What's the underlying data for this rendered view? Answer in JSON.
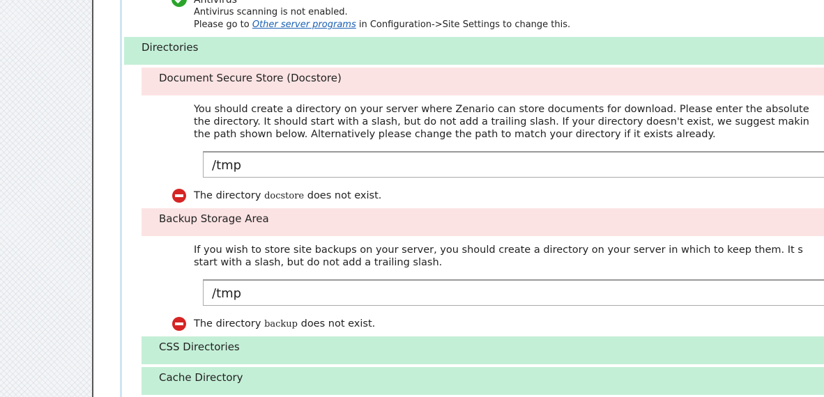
{
  "antivirus": {
    "title": "Antivirus",
    "status": "Antivirus scanning is not enabled.",
    "prefix": "Please go to ",
    "link": "Other server programs",
    "suffix": " in Configuration->Site Settings to change this."
  },
  "directories_header": "Directories",
  "docstore": {
    "title": "Document Secure Store (Docstore)",
    "lines": [
      "You should create a directory on your server where Zenario can store documents for download. Please enter the absolute",
      "the directory. It should start with a slash, but do not add a trailing slash. If your directory doesn't exist, we suggest makin",
      "the path shown below. Alternatively please change the path to match your directory if it exists already."
    ],
    "value": "/tmp",
    "error_prefix": "The directory ",
    "error_code": "docstore",
    "error_suffix": " does not exist."
  },
  "backup": {
    "title": "Backup Storage Area",
    "lines": [
      "If you wish to store site backups on your server, you should create a directory on your server in which to keep them. It s",
      "start with a slash, but do not add a trailing slash."
    ],
    "value": "/tmp",
    "error_prefix": "The directory ",
    "error_code": "backup",
    "error_suffix": " does not exist."
  },
  "css_directories": "CSS Directories",
  "cache_directory": "Cache Directory"
}
